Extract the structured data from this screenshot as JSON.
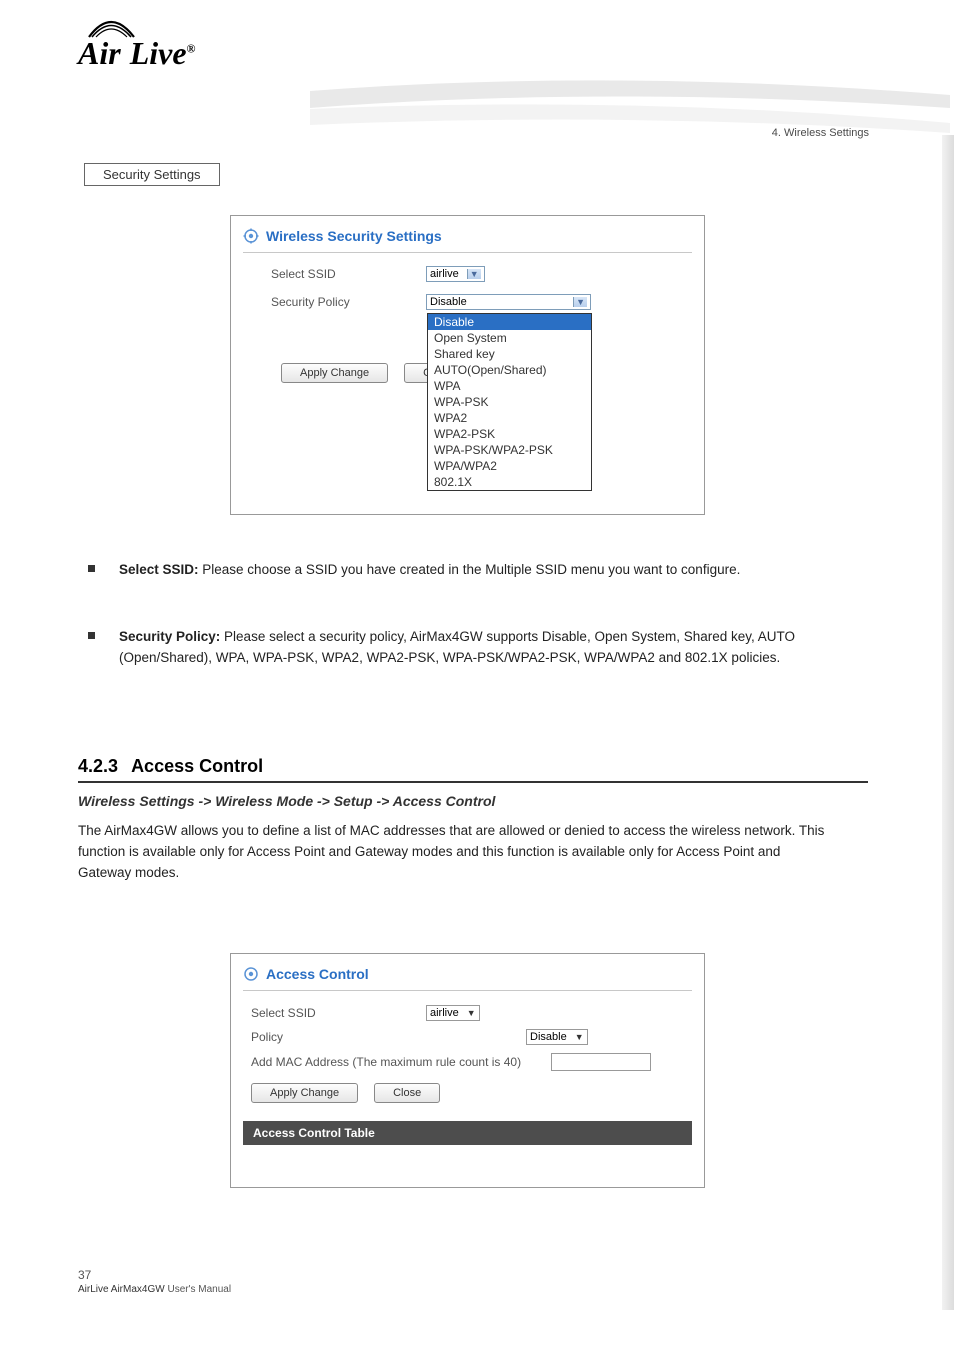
{
  "header": {
    "logo_prefix": "Air",
    "logo_suffix": "Live",
    "logo_mark": "®",
    "chapter": "4. Wireless Settings"
  },
  "section_button": "Security Settings",
  "panel1": {
    "title": "Wireless Security Settings",
    "ssid_label": "Select SSID",
    "ssid_value": "airlive",
    "policy_label": "Security Policy",
    "policy_value": "Disable",
    "options": [
      "Disable",
      "Open System",
      "Shared key",
      "AUTO(Open/Shared)",
      "WPA",
      "WPA-PSK",
      "WPA2",
      "WPA2-PSK",
      "WPA-PSK/WPA2-PSK",
      "WPA/WPA2",
      "802.1X"
    ],
    "apply": "Apply Change",
    "close": "Close"
  },
  "bullets": {
    "b1_title": "Select SSID:",
    "b1_text": " Please choose a SSID you have created in the Multiple SSID menu you want to configure.",
    "b2_title": "Security Policy:",
    "b2_text": " Please select a security policy, AirMax4GW supports Disable, Open System, Shared key, AUTO (Open/Shared), WPA, WPA-PSK, WPA2, WPA2-PSK, WPA-PSK/WPA2-PSK, WPA/WPA2 and 802.1X policies."
  },
  "heading": {
    "num": "4.2.3",
    "title": "Access Control",
    "breadcrumb": "Wireless Settings -> Wireless Mode -> Setup -> Access Control",
    "para": "The AirMax4GW allows you to define a list of MAC addresses that are allowed or denied to access the wireless network. This function is available only for Access Point and Gateway modes and this function is available only for Access Point and Gateway modes."
  },
  "panel2": {
    "title": "Access Control",
    "ssid_label": "Select SSID",
    "ssid_value": "airlive",
    "policy_label": "Policy",
    "policy_value": "Disable",
    "mac_label": "Add MAC Address (The maximum rule count is 40)",
    "apply": "Apply Change",
    "close": "Close",
    "table_header": "Access Control Table"
  },
  "footer": {
    "page": "37",
    "product": "AirLive AirMax4GW",
    "subtitle": " User's Manual"
  }
}
